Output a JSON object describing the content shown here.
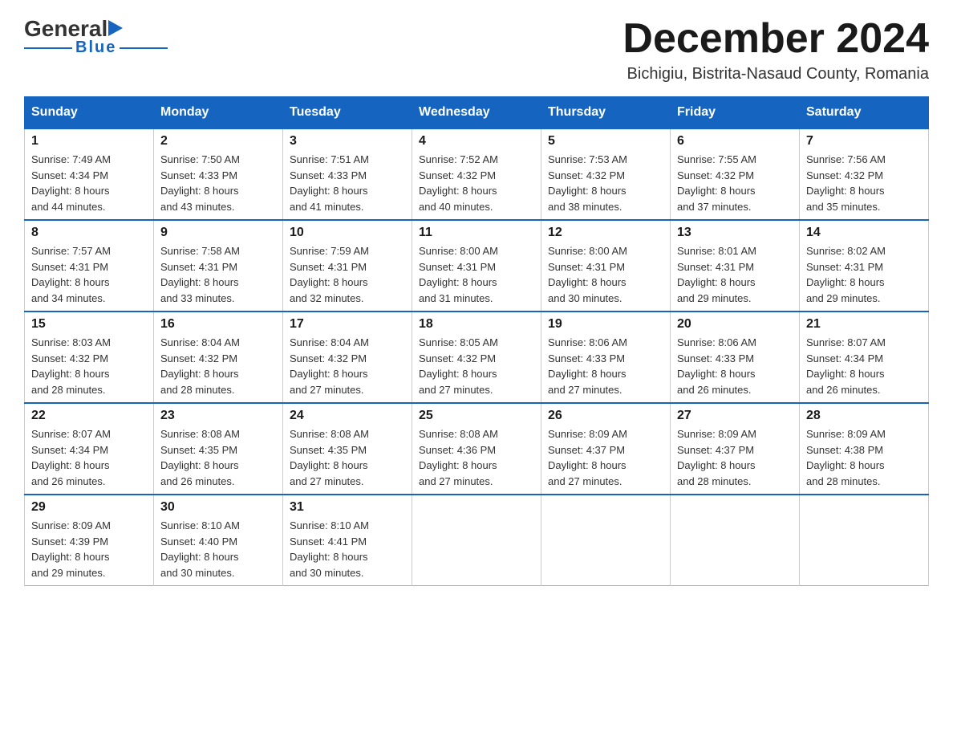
{
  "logo": {
    "general": "General",
    "blue": "Blue",
    "underline": "Blue"
  },
  "header": {
    "month_title": "December 2024",
    "location": "Bichigiu, Bistrita-Nasaud County, Romania"
  },
  "days_of_week": [
    "Sunday",
    "Monday",
    "Tuesday",
    "Wednesday",
    "Thursday",
    "Friday",
    "Saturday"
  ],
  "weeks": [
    [
      {
        "num": "1",
        "sunrise": "7:49 AM",
        "sunset": "4:34 PM",
        "daylight": "8 hours and 44 minutes."
      },
      {
        "num": "2",
        "sunrise": "7:50 AM",
        "sunset": "4:33 PM",
        "daylight": "8 hours and 43 minutes."
      },
      {
        "num": "3",
        "sunrise": "7:51 AM",
        "sunset": "4:33 PM",
        "daylight": "8 hours and 41 minutes."
      },
      {
        "num": "4",
        "sunrise": "7:52 AM",
        "sunset": "4:32 PM",
        "daylight": "8 hours and 40 minutes."
      },
      {
        "num": "5",
        "sunrise": "7:53 AM",
        "sunset": "4:32 PM",
        "daylight": "8 hours and 38 minutes."
      },
      {
        "num": "6",
        "sunrise": "7:55 AM",
        "sunset": "4:32 PM",
        "daylight": "8 hours and 37 minutes."
      },
      {
        "num": "7",
        "sunrise": "7:56 AM",
        "sunset": "4:32 PM",
        "daylight": "8 hours and 35 minutes."
      }
    ],
    [
      {
        "num": "8",
        "sunrise": "7:57 AM",
        "sunset": "4:31 PM",
        "daylight": "8 hours and 34 minutes."
      },
      {
        "num": "9",
        "sunrise": "7:58 AM",
        "sunset": "4:31 PM",
        "daylight": "8 hours and 33 minutes."
      },
      {
        "num": "10",
        "sunrise": "7:59 AM",
        "sunset": "4:31 PM",
        "daylight": "8 hours and 32 minutes."
      },
      {
        "num": "11",
        "sunrise": "8:00 AM",
        "sunset": "4:31 PM",
        "daylight": "8 hours and 31 minutes."
      },
      {
        "num": "12",
        "sunrise": "8:00 AM",
        "sunset": "4:31 PM",
        "daylight": "8 hours and 30 minutes."
      },
      {
        "num": "13",
        "sunrise": "8:01 AM",
        "sunset": "4:31 PM",
        "daylight": "8 hours and 29 minutes."
      },
      {
        "num": "14",
        "sunrise": "8:02 AM",
        "sunset": "4:31 PM",
        "daylight": "8 hours and 29 minutes."
      }
    ],
    [
      {
        "num": "15",
        "sunrise": "8:03 AM",
        "sunset": "4:32 PM",
        "daylight": "8 hours and 28 minutes."
      },
      {
        "num": "16",
        "sunrise": "8:04 AM",
        "sunset": "4:32 PM",
        "daylight": "8 hours and 28 minutes."
      },
      {
        "num": "17",
        "sunrise": "8:04 AM",
        "sunset": "4:32 PM",
        "daylight": "8 hours and 27 minutes."
      },
      {
        "num": "18",
        "sunrise": "8:05 AM",
        "sunset": "4:32 PM",
        "daylight": "8 hours and 27 minutes."
      },
      {
        "num": "19",
        "sunrise": "8:06 AM",
        "sunset": "4:33 PM",
        "daylight": "8 hours and 27 minutes."
      },
      {
        "num": "20",
        "sunrise": "8:06 AM",
        "sunset": "4:33 PM",
        "daylight": "8 hours and 26 minutes."
      },
      {
        "num": "21",
        "sunrise": "8:07 AM",
        "sunset": "4:34 PM",
        "daylight": "8 hours and 26 minutes."
      }
    ],
    [
      {
        "num": "22",
        "sunrise": "8:07 AM",
        "sunset": "4:34 PM",
        "daylight": "8 hours and 26 minutes."
      },
      {
        "num": "23",
        "sunrise": "8:08 AM",
        "sunset": "4:35 PM",
        "daylight": "8 hours and 26 minutes."
      },
      {
        "num": "24",
        "sunrise": "8:08 AM",
        "sunset": "4:35 PM",
        "daylight": "8 hours and 27 minutes."
      },
      {
        "num": "25",
        "sunrise": "8:08 AM",
        "sunset": "4:36 PM",
        "daylight": "8 hours and 27 minutes."
      },
      {
        "num": "26",
        "sunrise": "8:09 AM",
        "sunset": "4:37 PM",
        "daylight": "8 hours and 27 minutes."
      },
      {
        "num": "27",
        "sunrise": "8:09 AM",
        "sunset": "4:37 PM",
        "daylight": "8 hours and 28 minutes."
      },
      {
        "num": "28",
        "sunrise": "8:09 AM",
        "sunset": "4:38 PM",
        "daylight": "8 hours and 28 minutes."
      }
    ],
    [
      {
        "num": "29",
        "sunrise": "8:09 AM",
        "sunset": "4:39 PM",
        "daylight": "8 hours and 29 minutes."
      },
      {
        "num": "30",
        "sunrise": "8:10 AM",
        "sunset": "4:40 PM",
        "daylight": "8 hours and 30 minutes."
      },
      {
        "num": "31",
        "sunrise": "8:10 AM",
        "sunset": "4:41 PM",
        "daylight": "8 hours and 30 minutes."
      },
      null,
      null,
      null,
      null
    ]
  ],
  "labels": {
    "sunrise": "Sunrise:",
    "sunset": "Sunset:",
    "daylight": "Daylight:"
  }
}
